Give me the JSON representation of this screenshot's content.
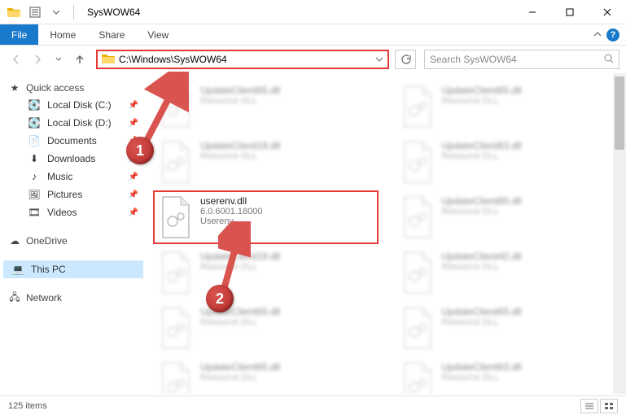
{
  "window": {
    "title": "SysWOW64"
  },
  "ribbon": {
    "file": "File",
    "home": "Home",
    "share": "Share",
    "view": "View"
  },
  "nav": {
    "address": "C:\\Windows\\SysWOW64",
    "search_placeholder": "Search SysWOW64"
  },
  "sidebar": {
    "quick_access": "Quick access",
    "items": [
      {
        "label": "Local Disk (C:)",
        "icon": "drive"
      },
      {
        "label": "Local Disk (D:)",
        "icon": "drive"
      },
      {
        "label": "Documents",
        "icon": "doc"
      },
      {
        "label": "Downloads",
        "icon": "download"
      },
      {
        "label": "Music",
        "icon": "music"
      },
      {
        "label": "Pictures",
        "icon": "picture"
      },
      {
        "label": "Videos",
        "icon": "video"
      }
    ],
    "onedrive": "OneDrive",
    "this_pc": "This PC",
    "network": "Network"
  },
  "files": {
    "highlighted": {
      "name": "userenv.dll",
      "version": "6.0.6001.18000",
      "desc": "Userenv"
    },
    "blur": [
      {
        "name": "UpdateClient65.dll",
        "desc": "Resource DLL"
      },
      {
        "name": "UpdateClient65.dll",
        "desc": "Resource DLL"
      },
      {
        "name": "UpdateClient19.dll",
        "desc": "Resource DLL"
      },
      {
        "name": "UpdateClient63.dll",
        "desc": "Resource DLL"
      },
      {
        "name": "UpdateClient65.dll",
        "desc": "Resource DLL"
      },
      {
        "name": "UpdateClient19.dll",
        "desc": "Resource DLL"
      },
      {
        "name": "UpdateClient42.dll",
        "desc": "Resource DLL"
      },
      {
        "name": "UpdateClient65.dll",
        "desc": "Resource DLL"
      },
      {
        "name": "UpdateClient65.dll",
        "desc": "Resource DLL"
      },
      {
        "name": "UpdateClient65.dll",
        "desc": "Resource DLL"
      },
      {
        "name": "UpdateClient63.dll",
        "desc": "Resource DLL"
      }
    ]
  },
  "status": {
    "count": "125 items"
  },
  "callouts": {
    "c1": "1",
    "c2": "2"
  }
}
